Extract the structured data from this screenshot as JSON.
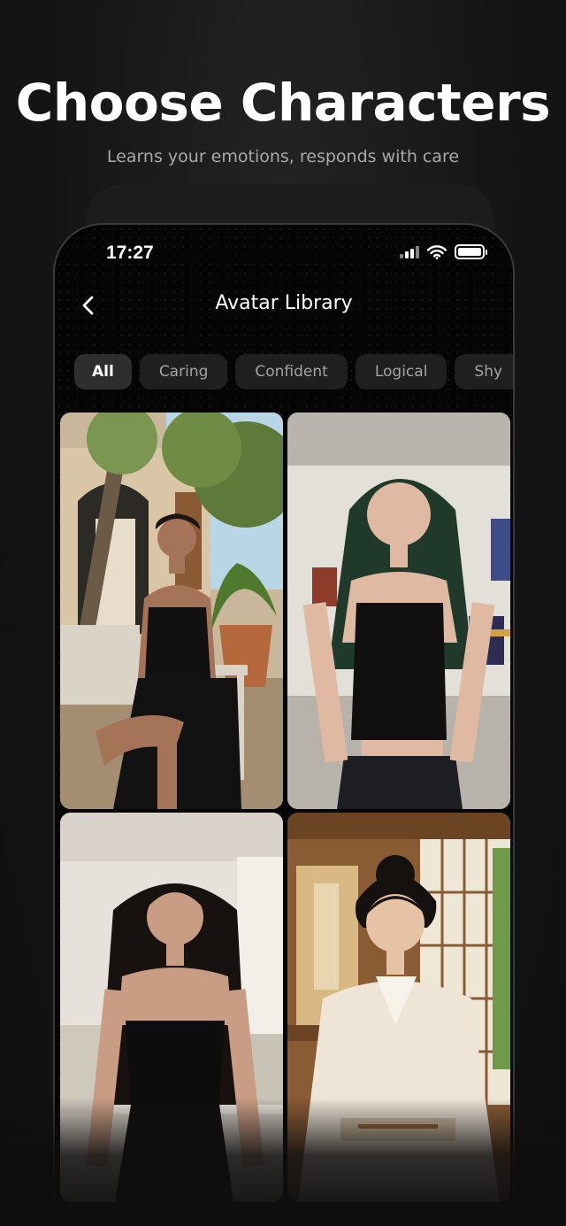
{
  "hero": {
    "title": "Choose Characters",
    "subtitle": "Learns your emotions, responds with care"
  },
  "status_bar": {
    "time": "17:27",
    "icons": [
      "signal-icon",
      "wifi-icon",
      "battery-icon"
    ]
  },
  "nav": {
    "title": "Avatar Library",
    "back_icon": "chevron-left-icon"
  },
  "tabs": [
    {
      "label": "All",
      "active": true
    },
    {
      "label": "Caring",
      "active": false
    },
    {
      "label": "Confident",
      "active": false
    },
    {
      "label": "Logical",
      "active": false
    },
    {
      "label": "Shy",
      "active": false
    }
  ],
  "avatars": [
    {
      "description": "woman in black dress on bench"
    },
    {
      "description": "woman with green hair"
    },
    {
      "description": "woman in strapless black dress"
    },
    {
      "description": "woman in kimono"
    }
  ]
}
